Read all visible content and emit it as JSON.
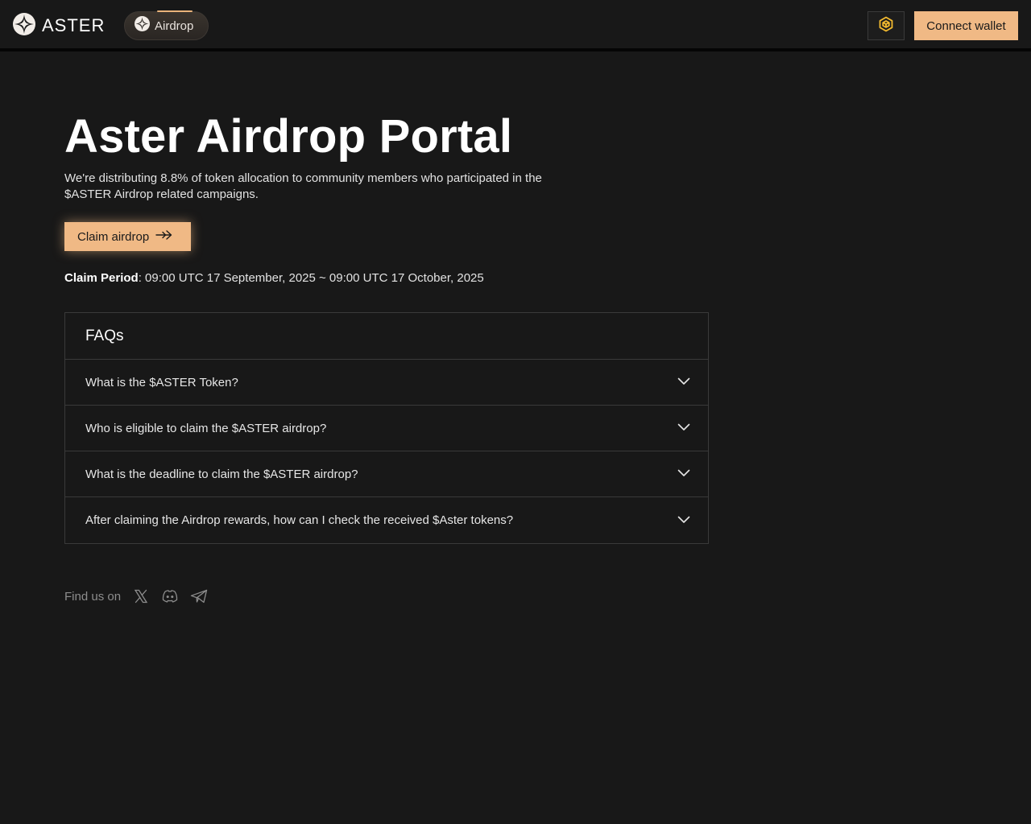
{
  "header": {
    "brand": "ASTER",
    "nav_airdrop": "Airdrop",
    "connect_wallet": "Connect wallet"
  },
  "hero": {
    "title": "Aster Airdrop Portal",
    "description": "We're distributing 8.8% of token allocation to community members who participated in the $ASTER Airdrop related campaigns.",
    "claim_button": "Claim airdrop",
    "claim_period_label": "Claim Period",
    "claim_period_value": ": 09:00 UTC 17 September, 2025 ~ 09:00 UTC 17 October, 2025"
  },
  "faq": {
    "title": "FAQs",
    "items": [
      {
        "question": "What is the $ASTER Token?"
      },
      {
        "question": "Who is eligible to claim the $ASTER airdrop?"
      },
      {
        "question": "What is the deadline to claim the $ASTER airdrop?"
      },
      {
        "question": "After claiming the Airdrop rewards, how can I check the received $Aster tokens?"
      }
    ]
  },
  "footer": {
    "find_us": "Find us on",
    "icons": [
      "x-icon",
      "discord-icon",
      "telegram-icon"
    ]
  },
  "colors": {
    "accent": "#f0b985",
    "background": "#181818",
    "border": "#3a3a3a",
    "bnb": "#f3ba2f"
  }
}
